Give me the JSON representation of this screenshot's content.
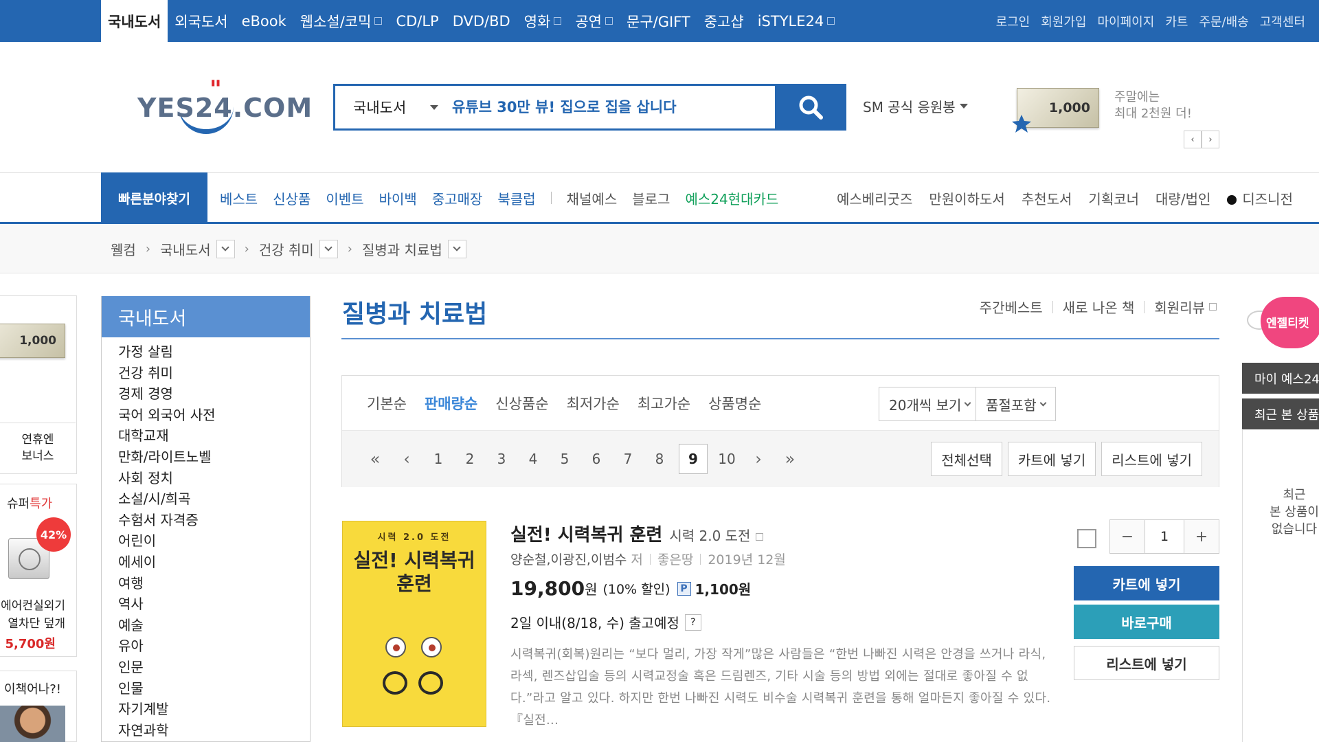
{
  "topbar": {
    "categories": [
      {
        "label": "국내도서"
      },
      {
        "label": "외국도서"
      },
      {
        "label": "eBook"
      },
      {
        "label": "웹소설/코믹"
      },
      {
        "label": "CD/LP"
      },
      {
        "label": "DVD/BD"
      },
      {
        "label": "영화"
      },
      {
        "label": "공연"
      },
      {
        "label": "문구/GIFT"
      },
      {
        "label": "중고샵"
      },
      {
        "label": "iSTYLE24"
      }
    ],
    "util": [
      "로그인",
      "회원가입",
      "마이페이지",
      "카트",
      "주문/배송",
      "고객센터"
    ]
  },
  "header": {
    "logo_text": "YES24.COM",
    "search_category": "국내도서",
    "search_placeholder": "유튜브 30만 뷰! 집으로 집을 삽니다",
    "sm_label": "SM 공식 응원봉",
    "gift_value": "1,000",
    "promo_line1": "주말에는",
    "promo_line2": "최대 2천원 더!"
  },
  "nav": {
    "quick": "빠른분야찾기",
    "items": [
      "베스트",
      "신상품",
      "이벤트",
      "바이백",
      "중고매장",
      "북클럽",
      "채널예스",
      "블로그",
      "예스24현대카드"
    ],
    "right": [
      "예스베리굿즈",
      "만원이하도서",
      "추천도서",
      "기획코너",
      "대량/법인",
      "디즈니전"
    ]
  },
  "breadcrumb": [
    "웰컴",
    "국내도서",
    "건강 취미",
    "질병과 치료법"
  ],
  "left_ads": {
    "gift_value": "1,000",
    "bonus_line1": "연휴엔",
    "bonus_line2": "보너스",
    "super_title": "슈퍼",
    "super_title_accent": "특가",
    "discount": "42%",
    "desc_line1": "에어컨실외기",
    "desc_line2": "열차단 덮개",
    "price": "5,700원",
    "book_title": "이책어나?!"
  },
  "category_panel": {
    "title": "국내도서",
    "items": [
      "가정 살림",
      "건강 취미",
      "경제 경영",
      "국어 외국어 사전",
      "대학교재",
      "만화/라이트노벨",
      "사회 정치",
      "소설/시/희곡",
      "수험서 자격증",
      "어린이",
      "에세이",
      "여행",
      "역사",
      "예술",
      "유아",
      "인문",
      "인물",
      "자기계발",
      "자연과학"
    ]
  },
  "main": {
    "title": "질병과 치료법",
    "links": [
      "주간베스트",
      "새로 나온 책",
      "회원리뷰"
    ],
    "sorts": [
      "기본순",
      "판매량순",
      "신상품순",
      "최저가순",
      "최고가순",
      "상품명순"
    ],
    "active_sort": "판매량순",
    "per_page": "20개씩 보기",
    "stock": "품절포함",
    "pages": [
      "1",
      "2",
      "3",
      "4",
      "5",
      "6",
      "7",
      "8",
      "9",
      "10"
    ],
    "current_page": "9",
    "actions": [
      "전체선택",
      "카트에 넣기",
      "리스트에 넣기"
    ]
  },
  "product": {
    "cover_top": "시력 2.0 도전",
    "cover_title": "실전! 시력복귀 훈련",
    "title": "실전! 시력복귀 훈련",
    "subtitle": "시력 2.0 도전",
    "authors": "양순철,이광진,이범수",
    "author_suffix": "저",
    "publisher": "좋은땅",
    "date": "2019년 12월",
    "price": "19,800",
    "price_unit": "원",
    "discount": "(10% 할인)",
    "points_badge": "P",
    "points": "1,100원",
    "shipping": "2일 이내(8/18, 수) 출고예정",
    "help": "?",
    "description": "시력복귀(회복)원리는 “보다 멀리, 가장 작게”많은 사람들은 “한번 나빠진 시력은 안경을 쓰거나 라식, 라섹, 렌즈삽입술 등의 시력교정술 혹은 드림렌즈, 기타 시술 등의 방법 외에는 절대로 좋아질 수 없다.”라고 알고 있다. 하지만 한번 나빠진 시력도 비수술 시력복귀 훈련을 통해 얼마든지 좋아질 수 있다. 『실전...",
    "quantity": "1",
    "minus": "−",
    "plus": "+",
    "cart_btn": "카트에 넣기",
    "buy_btn": "바로구매",
    "list_btn": "리스트에 넣기"
  },
  "right_sidebar": {
    "angel": "엔젤티켓",
    "my": "마이 예스24",
    "recent_title": "최근 본 상품",
    "recent_empty_1": "최근",
    "recent_empty_2": "본 상품이",
    "recent_empty_3": "없습니다"
  },
  "colors": {
    "brand_blue": "#2466b1",
    "sort_active": "#3a86d8",
    "buy_teal": "#2c9fb8",
    "price_red": "#d92828"
  }
}
